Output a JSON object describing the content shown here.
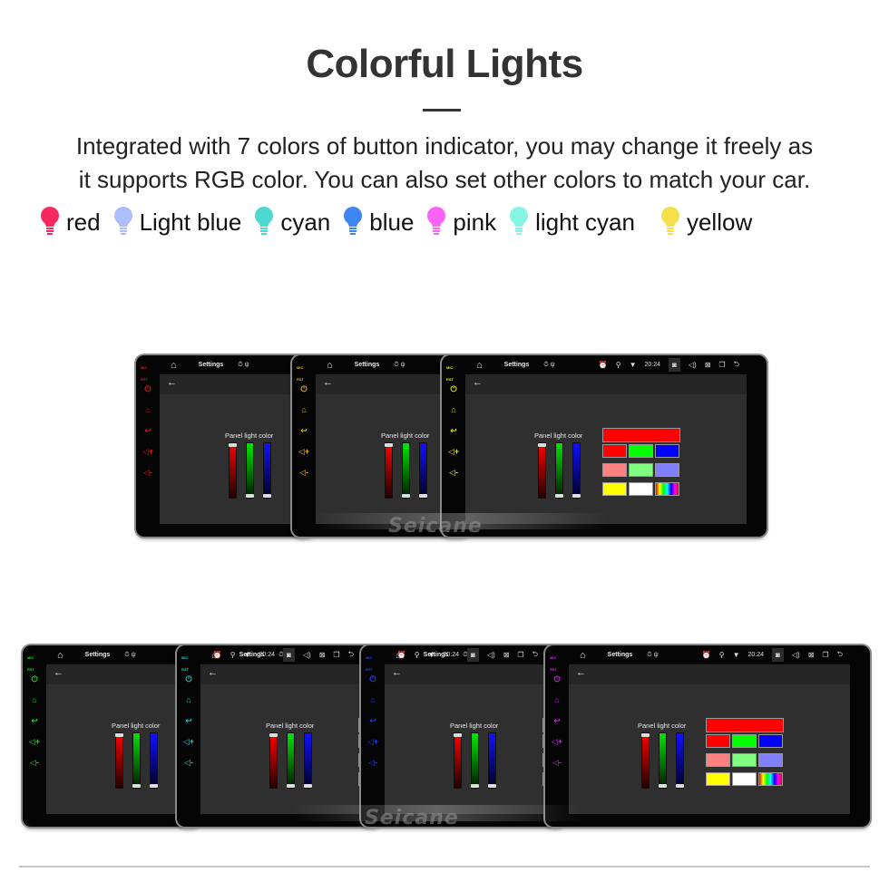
{
  "header": {
    "title": "Colorful Lights",
    "description_line1": "Integrated with 7 colors of button indicator, you may change it freely as",
    "description_line2": "it supports RGB color. You can also set other colors to match your car."
  },
  "legend": [
    {
      "label": "red",
      "color": "#f7285e",
      "icon": "lightbulb-icon"
    },
    {
      "label": "Light blue",
      "color": "#aebdfd",
      "icon": "lightbulb-icon"
    },
    {
      "label": "cyan",
      "color": "#4ed8d2",
      "icon": "lightbulb-icon"
    },
    {
      "label": "blue",
      "color": "#3f86f5",
      "icon": "lightbulb-icon"
    },
    {
      "label": "pink",
      "color": "#fb63f5",
      "icon": "lightbulb-icon"
    },
    {
      "label": "light cyan",
      "color": "#86f5e4",
      "icon": "lightbulb-icon"
    },
    {
      "label": "yellow",
      "color": "#f4e04a",
      "icon": "lightbulb-icon"
    }
  ],
  "device_ui": {
    "mic_label": "MIC",
    "rst_label": "RST",
    "settings_title": "Settings",
    "time": "20:24",
    "panel_label": "Panel light color",
    "side_buttons": [
      "power-icon",
      "home-icon",
      "back-icon",
      "volume-up-icon",
      "volume-down-icon"
    ],
    "status_icons": [
      "alarm-icon",
      "location-icon",
      "wifi-icon",
      "camera-icon",
      "volume-icon",
      "close-window-icon",
      "recent-apps-icon",
      "return-icon"
    ],
    "swatches": [
      "#ff0000",
      "#ff0000",
      "#00ff00",
      "#0000ff",
      "#ff8080",
      "#80ff80",
      "#8080ff",
      "#ffff00",
      "#ffffff",
      "rainbow"
    ],
    "red_level": 1.0,
    "green_level": 0.0,
    "blue_level": 0.0
  },
  "devices": [
    {
      "button_color": "#e0141e"
    },
    {
      "button_color": "#e8b400"
    },
    {
      "button_color": "#e6e600"
    },
    {
      "button_color": "#22d622"
    },
    {
      "button_color": "#1ec8c8"
    },
    {
      "button_color": "#1e3cff"
    },
    {
      "button_color": "#c828e6"
    }
  ],
  "watermark": "Seicane"
}
